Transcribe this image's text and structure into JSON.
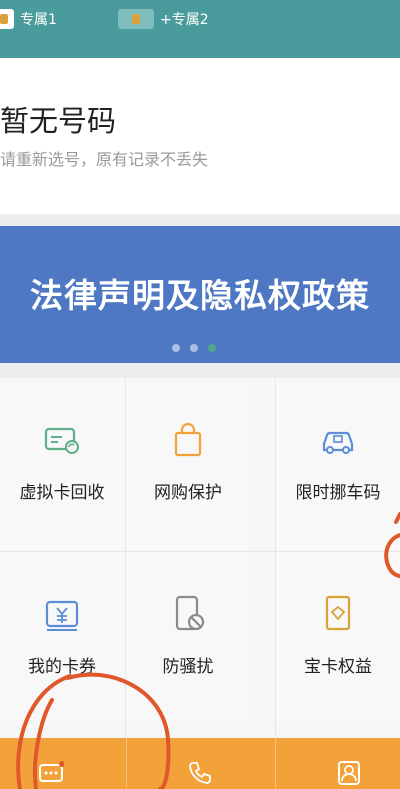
{
  "tabs": [
    {
      "label": "专属1",
      "active": true
    },
    {
      "label": "+专属2",
      "active": false
    }
  ],
  "number_card": {
    "title": "暂无号码",
    "subtitle": "请重新选号，原有记录不丢失"
  },
  "banner": {
    "text": "法律声明及隐私权政策",
    "pages": 3,
    "active_page": 3,
    "color": "#4f78c4"
  },
  "services": [
    {
      "label": "虚拟卡回收",
      "icon": "card-recycle-icon"
    },
    {
      "label": "网购保护",
      "icon": "shopping-bag-icon"
    },
    {
      "label": "限时挪车码",
      "icon": "car-icon"
    },
    {
      "label": "我的卡券",
      "icon": "coupon-icon"
    },
    {
      "label": "防骚扰",
      "icon": "phone-block-icon"
    },
    {
      "label": "宝卡权益",
      "icon": "benefit-icon"
    }
  ],
  "bottom_nav": [
    {
      "icon": "message-icon"
    },
    {
      "icon": "phone-icon"
    },
    {
      "icon": "contacts-icon"
    }
  ],
  "colors": {
    "header": "#4a9b9b",
    "icon_accent": "#f3a23a",
    "bottom_bar": "#f3a23a",
    "annotation": "#e0582a"
  }
}
